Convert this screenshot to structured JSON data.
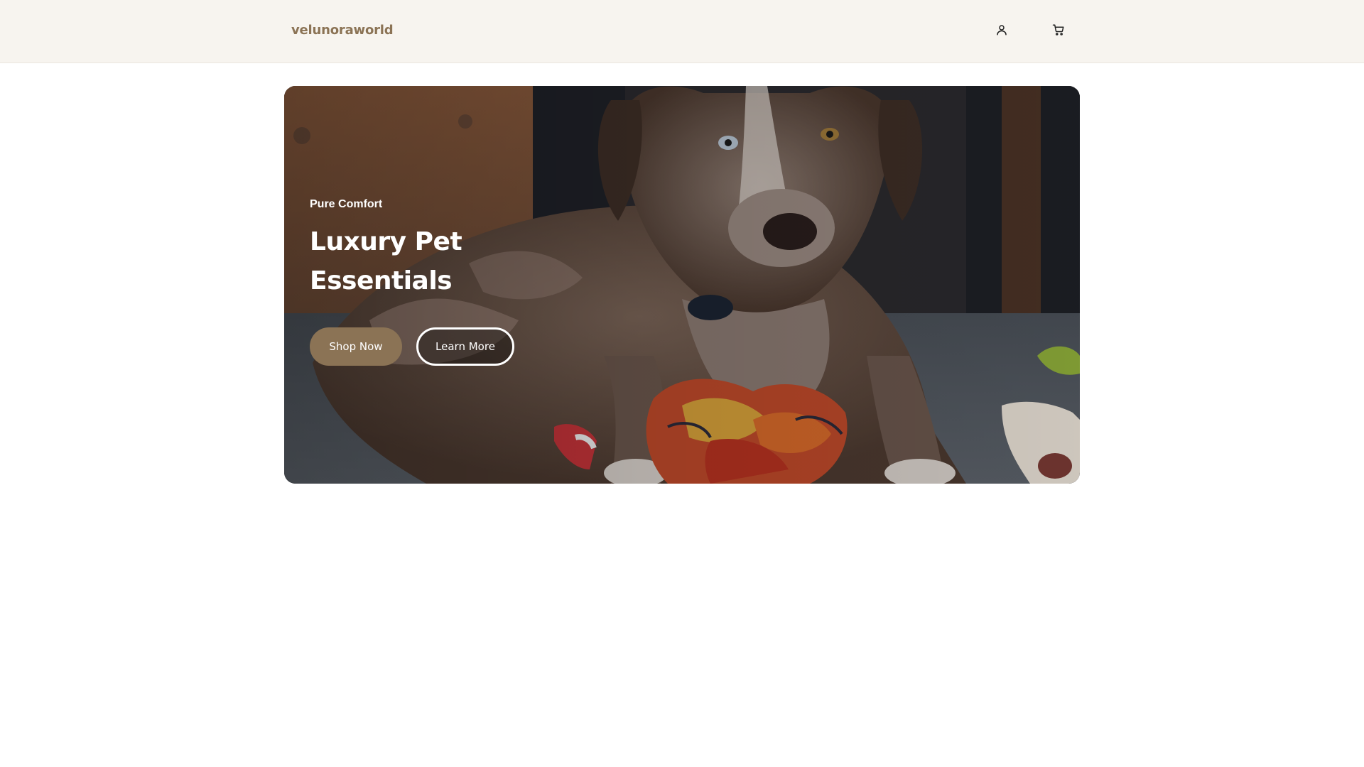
{
  "header": {
    "brand": "velunoraworld",
    "account_icon": "user-icon",
    "cart_icon": "shopping-cart-icon"
  },
  "hero": {
    "kicker": "Pure Comfort",
    "title_line1": "Luxury Pet",
    "title_line2": "Essentials",
    "primary_button": "Shop Now",
    "secondary_button": "Learn More"
  },
  "colors": {
    "brand": "#8b7355",
    "header_bg": "#f7f4ef",
    "text_light": "#ffffff"
  }
}
